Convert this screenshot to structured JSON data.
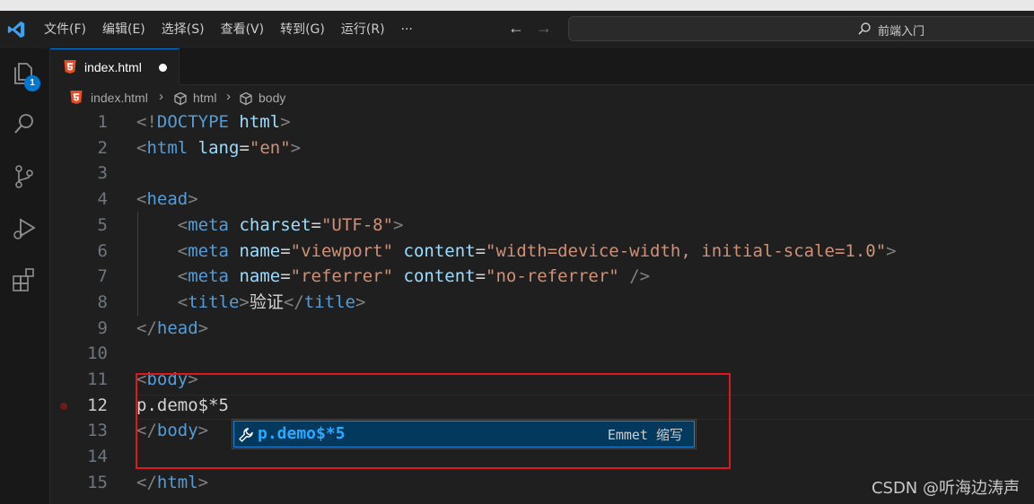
{
  "menu": [
    "文件(F)",
    "编辑(E)",
    "选择(S)",
    "查看(V)",
    "转到(G)",
    "运行(R)",
    "···"
  ],
  "search": {
    "text": "前端入门"
  },
  "activity": {
    "explorer_badge": "1"
  },
  "tab": {
    "label": "index.html"
  },
  "breadcrumb": [
    "index.html",
    "html",
    "body"
  ],
  "editor": {
    "active_line": 12,
    "lines": [
      {
        "n": "1",
        "tokens": [
          [
            "br",
            "<!"
          ],
          [
            "tag",
            "DOCTYPE"
          ],
          [
            "txt",
            " "
          ],
          [
            "attr",
            "html"
          ],
          [
            "br",
            ">"
          ]
        ]
      },
      {
        "n": "2",
        "tokens": [
          [
            "br",
            "<"
          ],
          [
            "tag",
            "html"
          ],
          [
            "txt",
            " "
          ],
          [
            "attr",
            "lang"
          ],
          [
            "txt",
            "="
          ],
          [
            "str",
            "\"en\""
          ],
          [
            "br",
            ">"
          ]
        ]
      },
      {
        "n": "3",
        "tokens": []
      },
      {
        "n": "4",
        "tokens": [
          [
            "br",
            "<"
          ],
          [
            "tag",
            "head"
          ],
          [
            "br",
            ">"
          ]
        ]
      },
      {
        "n": "5",
        "tokens": [
          [
            "txt",
            "    "
          ],
          [
            "br",
            "<"
          ],
          [
            "tag",
            "meta"
          ],
          [
            "txt",
            " "
          ],
          [
            "attr",
            "charset"
          ],
          [
            "txt",
            "="
          ],
          [
            "str",
            "\"UTF-8\""
          ],
          [
            "br",
            ">"
          ]
        ]
      },
      {
        "n": "6",
        "tokens": [
          [
            "txt",
            "    "
          ],
          [
            "br",
            "<"
          ],
          [
            "tag",
            "meta"
          ],
          [
            "txt",
            " "
          ],
          [
            "attr",
            "name"
          ],
          [
            "txt",
            "="
          ],
          [
            "str",
            "\"viewport\""
          ],
          [
            "txt",
            " "
          ],
          [
            "attr",
            "content"
          ],
          [
            "txt",
            "="
          ],
          [
            "str",
            "\"width=device-width, initial-scale=1.0\""
          ],
          [
            "br",
            ">"
          ]
        ]
      },
      {
        "n": "7",
        "tokens": [
          [
            "txt",
            "    "
          ],
          [
            "br",
            "<"
          ],
          [
            "tag",
            "meta"
          ],
          [
            "txt",
            " "
          ],
          [
            "attr",
            "name"
          ],
          [
            "txt",
            "="
          ],
          [
            "str",
            "\"referrer\""
          ],
          [
            "txt",
            " "
          ],
          [
            "attr",
            "content"
          ],
          [
            "txt",
            "="
          ],
          [
            "str",
            "\"no-referrer\""
          ],
          [
            "txt",
            " "
          ],
          [
            "br",
            "/>"
          ]
        ]
      },
      {
        "n": "8",
        "tokens": [
          [
            "txt",
            "    "
          ],
          [
            "br",
            "<"
          ],
          [
            "tag",
            "title"
          ],
          [
            "br",
            ">"
          ],
          [
            "txt",
            "验证"
          ],
          [
            "br",
            "</"
          ],
          [
            "tag",
            "title"
          ],
          [
            "br",
            ">"
          ]
        ]
      },
      {
        "n": "9",
        "tokens": [
          [
            "br",
            "</"
          ],
          [
            "tag",
            "head"
          ],
          [
            "br",
            ">"
          ]
        ]
      },
      {
        "n": "10",
        "tokens": []
      },
      {
        "n": "11",
        "tokens": [
          [
            "br",
            "<"
          ],
          [
            "tag",
            "body"
          ],
          [
            "br",
            ">"
          ]
        ]
      },
      {
        "n": "12",
        "tokens": [
          [
            "txt",
            "p.demo$*5"
          ]
        ]
      },
      {
        "n": "13",
        "tokens": [
          [
            "br",
            "</"
          ],
          [
            "tag",
            "body"
          ],
          [
            "br",
            ">"
          ]
        ]
      },
      {
        "n": "14",
        "tokens": []
      },
      {
        "n": "15",
        "tokens": [
          [
            "br",
            "</"
          ],
          [
            "tag",
            "html"
          ],
          [
            "br",
            ">"
          ]
        ]
      }
    ]
  },
  "suggestion": {
    "label": "p.demo$*5",
    "detail": "Emmet 缩写"
  },
  "watermark": "CSDN @听海边涛声",
  "colors": {
    "accent": "#0078d4",
    "highlight": "#e0161f",
    "tag": "#569cd6",
    "attr": "#9cdcfe",
    "string": "#ce9178"
  }
}
